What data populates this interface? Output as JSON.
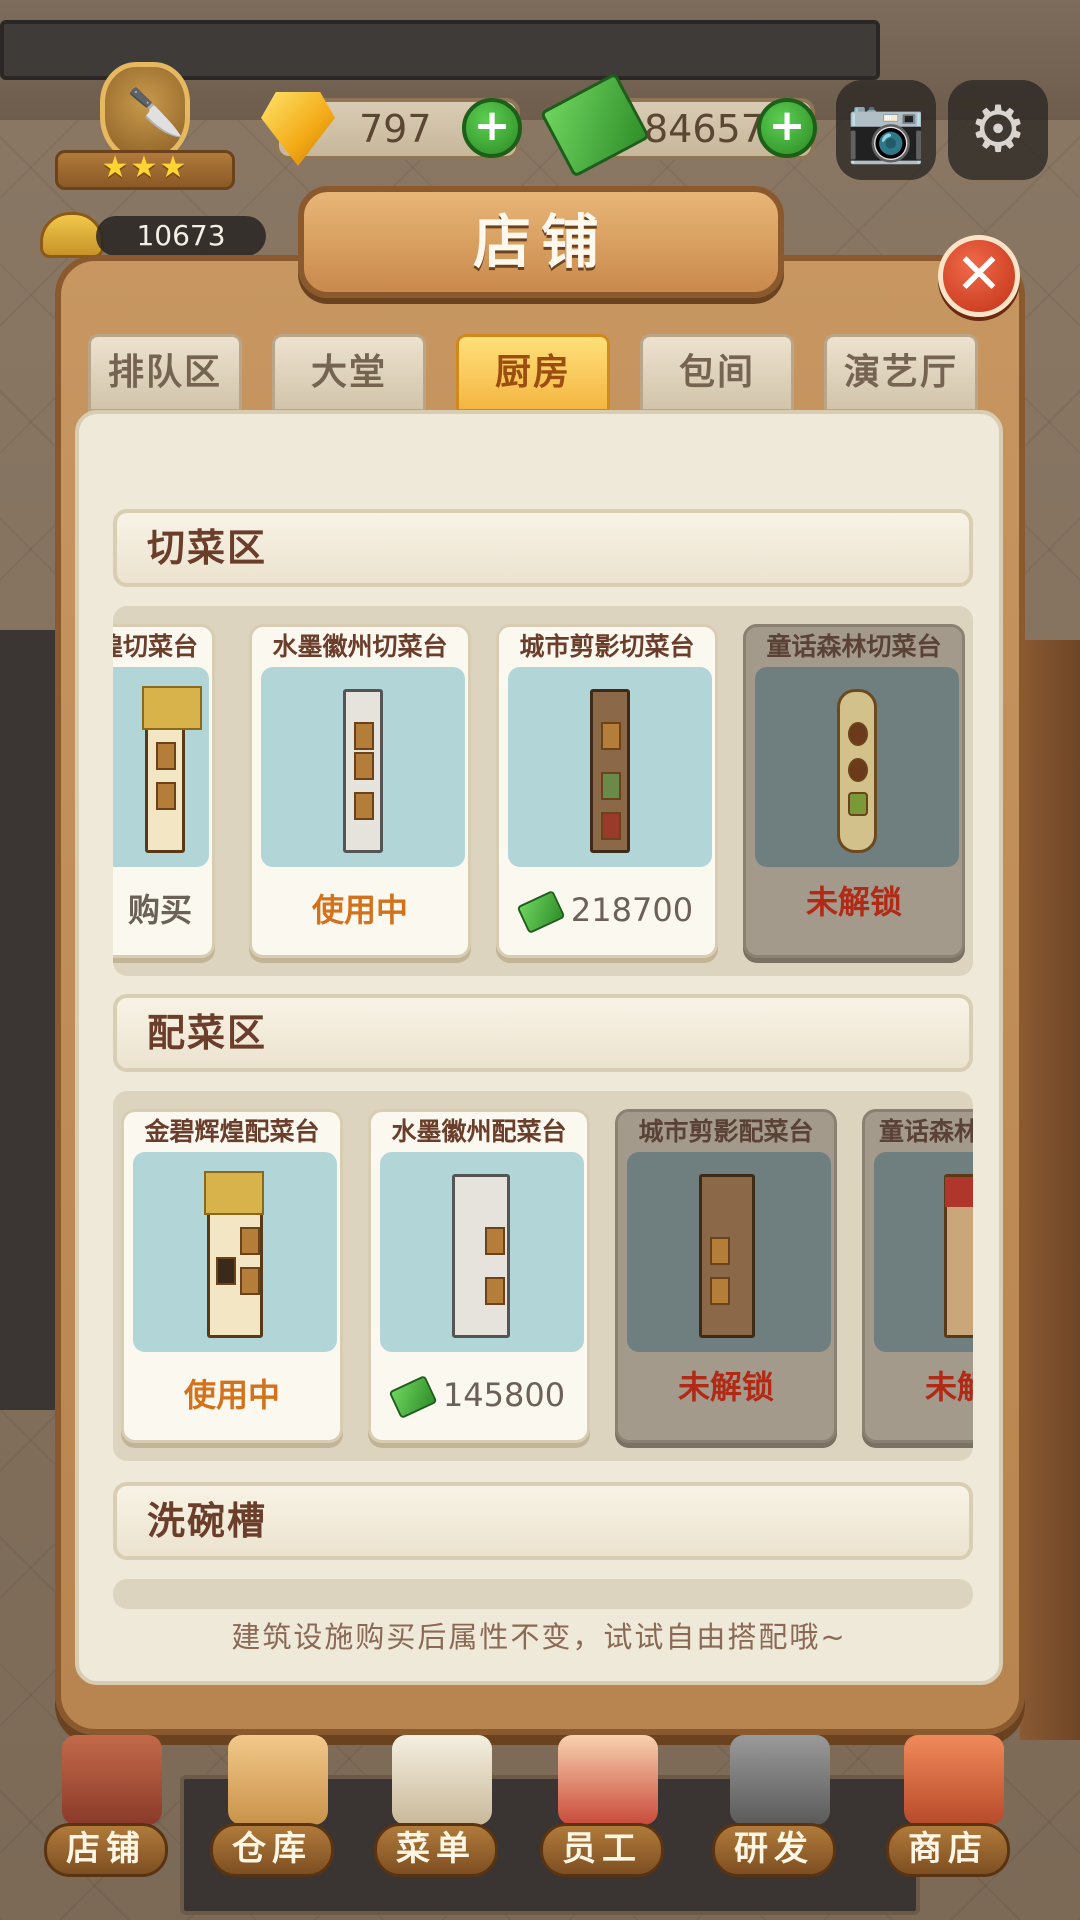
{
  "hud": {
    "gems": "797",
    "cash": "84657",
    "level_value": "10673",
    "add_icon": "plus-icon",
    "camera_icon": "camera-icon",
    "settings_icon": "gear-icon"
  },
  "dialog": {
    "title": "店铺",
    "close_icon": "close-icon",
    "tabs": [
      {
        "label": "排队区",
        "active": false
      },
      {
        "label": "大堂",
        "active": false
      },
      {
        "label": "厨房",
        "active": true
      },
      {
        "label": "包间",
        "active": false
      },
      {
        "label": "演艺厅",
        "active": false
      }
    ],
    "sections": [
      {
        "title": "切菜区",
        "cards": [
          {
            "name": "煌切菜台",
            "status": "购买",
            "state": "partial"
          },
          {
            "name": "水墨徽州切菜台",
            "status": "使用中",
            "state": "in_use"
          },
          {
            "name": "城市剪影切菜台",
            "price": "218700",
            "state": "buy"
          },
          {
            "name": "童话森林切菜台",
            "status": "未解锁",
            "state": "locked"
          }
        ]
      },
      {
        "title": "配菜区",
        "cards": [
          {
            "name": "金碧辉煌配菜台",
            "status": "使用中",
            "state": "in_use"
          },
          {
            "name": "水墨徽州配菜台",
            "price": "145800",
            "state": "buy"
          },
          {
            "name": "城市剪影配菜台",
            "status": "未解锁",
            "state": "locked"
          },
          {
            "name": "童话森林",
            "status": "未解",
            "state": "locked"
          }
        ]
      },
      {
        "title": "洗碗槽",
        "cards": []
      }
    ],
    "hint": "建筑设施购买后属性不变，试试自由搭配哦~"
  },
  "bottom_nav": [
    {
      "label": "店铺",
      "icon": "shop-building-icon"
    },
    {
      "label": "仓库",
      "icon": "warehouse-boxes-icon"
    },
    {
      "label": "菜单",
      "icon": "menu-clipboard-icon"
    },
    {
      "label": "员工",
      "icon": "staff-chef-icon"
    },
    {
      "label": "研发",
      "icon": "research-wok-icon"
    },
    {
      "label": "商店",
      "icon": "store-front-icon"
    }
  ],
  "colors": {
    "accent_active_tab": "#f4b642",
    "status_in_use": "#d4721c",
    "status_locked": "#b02a16",
    "close_red": "#c23216"
  }
}
